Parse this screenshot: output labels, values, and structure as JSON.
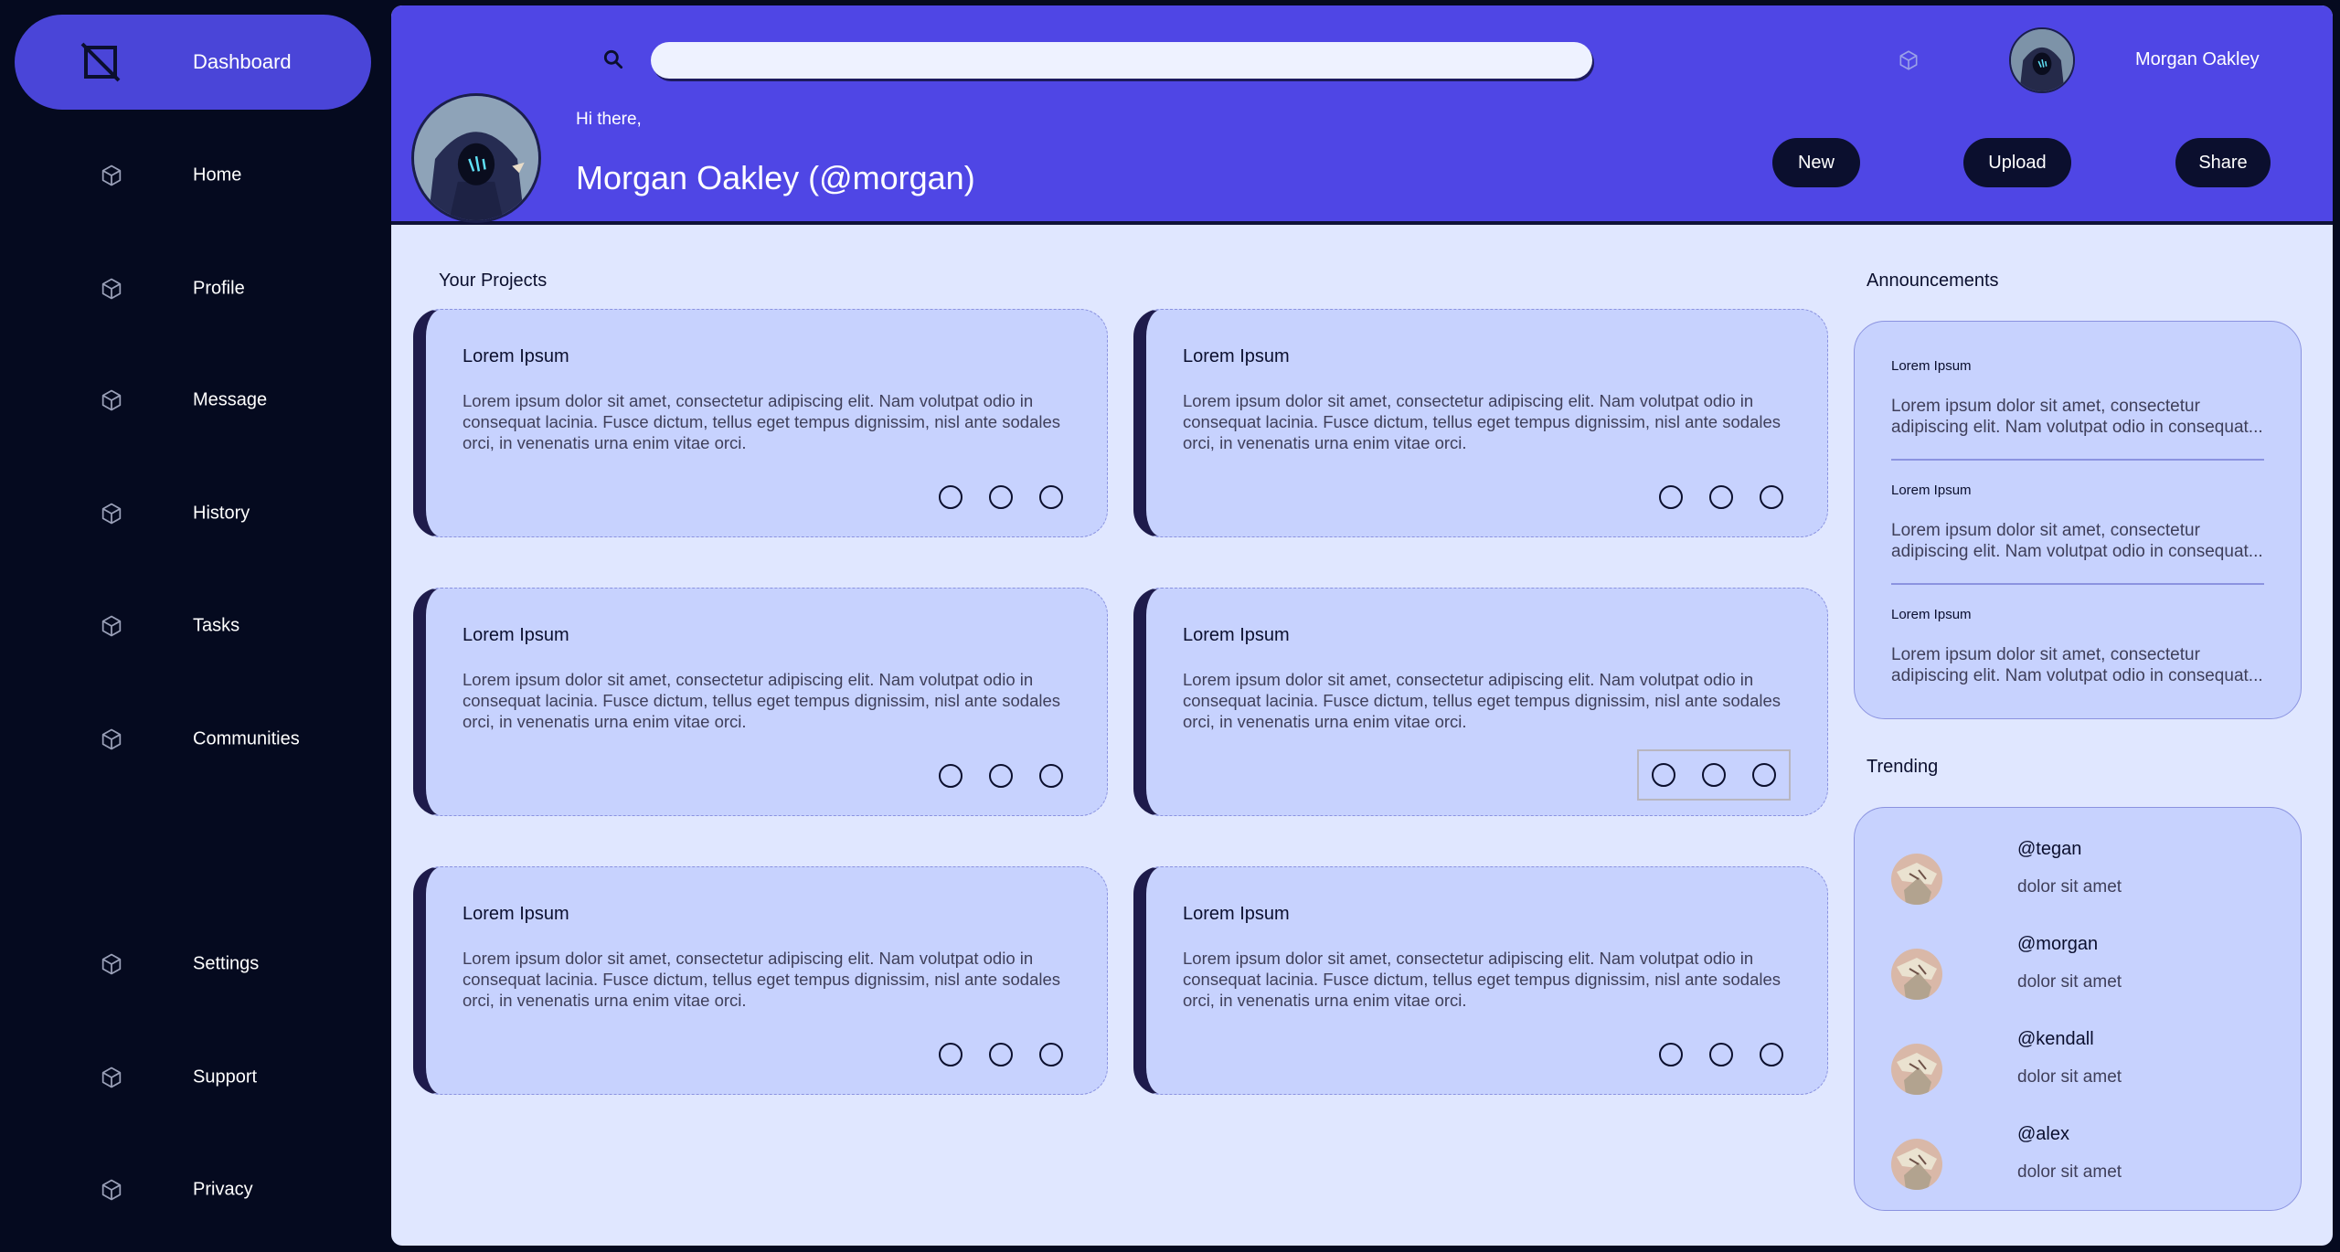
{
  "colors": {
    "sidebar_bg": "#050a1f",
    "accent": "#4f46e5",
    "active_nav": "#4a45d8",
    "card_bg": "#c7d2fe",
    "main_bg": "#e0e7ff",
    "button_bg": "#0b0f2e"
  },
  "sidebar": {
    "items": [
      {
        "label": "Dashboard",
        "icon": "dashboard-logo-icon",
        "active": true
      },
      {
        "label": "Home",
        "icon": "cube-icon"
      },
      {
        "label": "Profile",
        "icon": "cube-icon"
      },
      {
        "label": "Message",
        "icon": "cube-icon"
      },
      {
        "label": "History",
        "icon": "cube-icon"
      },
      {
        "label": "Tasks",
        "icon": "cube-icon"
      },
      {
        "label": "Communities",
        "icon": "cube-icon"
      },
      {
        "label": "Settings",
        "icon": "cube-icon"
      },
      {
        "label": "Support",
        "icon": "cube-icon"
      },
      {
        "label": "Privacy",
        "icon": "cube-icon"
      }
    ]
  },
  "header": {
    "search": {
      "value": "",
      "placeholder": ""
    },
    "user_name": "Morgan Oakley",
    "greeting": "Hi there,",
    "profile_name": "Morgan Oakley (@morgan)",
    "buttons": {
      "new": "New",
      "upload": "Upload",
      "share": "Share"
    }
  },
  "projects": {
    "title": "Your Projects",
    "cards": [
      {
        "title": "Lorem Ipsum",
        "body": "Lorem ipsum dolor sit amet, consectetur adipiscing elit. Nam volutpat odio in consequat lacinia. Fusce dictum, tellus eget tempus dignissim, nisl ante sodales orci, in venenatis urna enim vitae orci."
      },
      {
        "title": "Lorem Ipsum",
        "body": "Lorem ipsum dolor sit amet, consectetur adipiscing elit. Nam volutpat odio in consequat lacinia. Fusce dictum, tellus eget tempus dignissim, nisl ante sodales orci, in venenatis urna enim vitae orci."
      },
      {
        "title": "Lorem Ipsum",
        "body": "Lorem ipsum dolor sit amet, consectetur adipiscing elit. Nam volutpat odio in consequat lacinia. Fusce dictum, tellus eget tempus dignissim, nisl ante sodales orci, in venenatis urna enim vitae orci."
      },
      {
        "title": "Lorem Ipsum",
        "body": "Lorem ipsum dolor sit amet, consectetur adipiscing elit. Nam volutpat odio in consequat lacinia. Fusce dictum, tellus eget tempus dignissim, nisl ante sodales orci, in venenatis urna enim vitae orci."
      },
      {
        "title": "Lorem Ipsum",
        "body": "Lorem ipsum dolor sit amet, consectetur adipiscing elit. Nam volutpat odio in consequat lacinia. Fusce dictum, tellus eget tempus dignissim, nisl ante sodales orci, in venenatis urna enim vitae orci."
      },
      {
        "title": "Lorem Ipsum",
        "body": "Lorem ipsum dolor sit amet, consectetur adipiscing elit. Nam volutpat odio in consequat lacinia. Fusce dictum, tellus eget tempus dignissim, nisl ante sodales orci, in venenatis urna enim vitae orci."
      }
    ]
  },
  "announcements": {
    "title": "Announcements",
    "items": [
      {
        "title": "Lorem Ipsum",
        "body": "Lorem ipsum dolor sit amet, consectetur adipiscing elit. Nam volutpat odio in consequat..."
      },
      {
        "title": "Lorem Ipsum",
        "body": "Lorem ipsum dolor sit amet, consectetur adipiscing elit. Nam volutpat odio in consequat..."
      },
      {
        "title": "Lorem Ipsum",
        "body": "Lorem ipsum dolor sit amet, consectetur adipiscing elit. Nam volutpat odio in consequat..."
      }
    ]
  },
  "trending": {
    "title": "Trending",
    "items": [
      {
        "handle": "@tegan",
        "text": "dolor sit amet"
      },
      {
        "handle": "@morgan",
        "text": "dolor sit amet"
      },
      {
        "handle": "@kendall",
        "text": "dolor sit amet"
      },
      {
        "handle": "@alex",
        "text": "dolor sit amet"
      }
    ]
  }
}
